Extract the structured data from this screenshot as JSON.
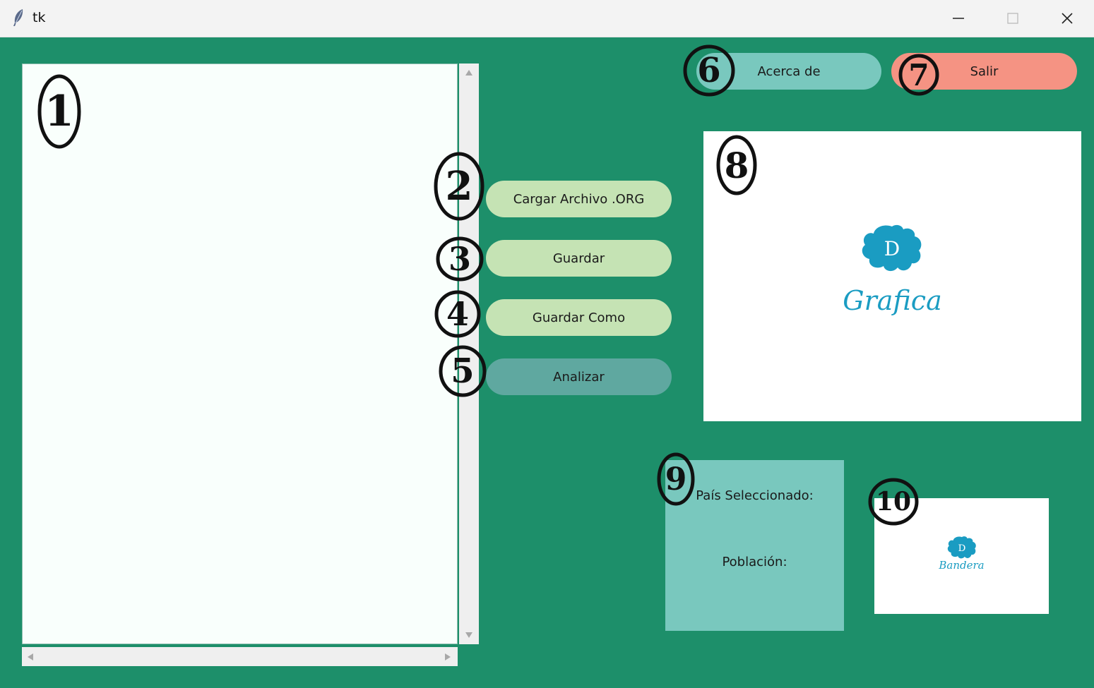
{
  "window": {
    "title": "tk",
    "controls": {
      "minimize": "minimize-icon",
      "maximize": "maximize-icon",
      "close": "close-icon"
    }
  },
  "buttons": {
    "load": "Cargar Archivo .ORG",
    "save": "Guardar",
    "save_as": "Guardar Como",
    "analyze": "Analizar",
    "about": "Acerca de",
    "exit": "Salir"
  },
  "graph_panel": {
    "logo_letter": "D",
    "caption": "Grafica"
  },
  "info_panel": {
    "country_label": "País Seleccionado:",
    "population_label": "Población:"
  },
  "flag_panel": {
    "logo_letter": "D",
    "caption": "Bandera"
  },
  "annotations": [
    "1",
    "2",
    "3",
    "4",
    "5",
    "6",
    "7",
    "8",
    "9",
    "10"
  ],
  "colors": {
    "background": "#1d8f6a",
    "button_light": "#c5e3b4",
    "button_analyze": "#5fa8a0",
    "button_about": "#79c8be",
    "button_exit": "#f59383",
    "logo": "#1a9cc2"
  }
}
